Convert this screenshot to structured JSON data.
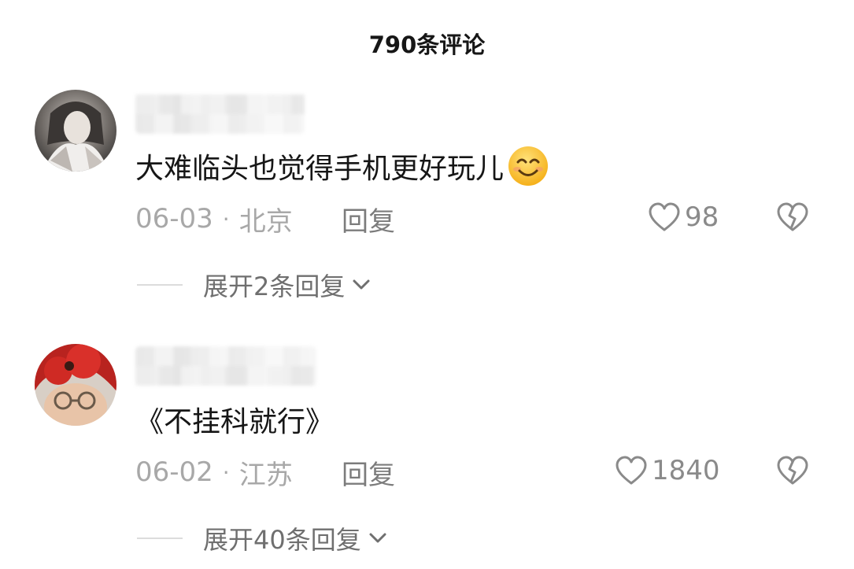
{
  "header": {
    "title": "790条评论"
  },
  "comments": [
    {
      "text": "大难临头也觉得手机更好玩儿",
      "emoji": "smiling-face-icon",
      "date": "06-03",
      "location": "北京",
      "reply_label": "回复",
      "likes": "98",
      "expand_label": "展开2条回复"
    },
    {
      "text": "《不挂科就行》",
      "date": "06-02",
      "location": "江苏",
      "reply_label": "回复",
      "likes": "1840",
      "expand_label": "展开40条回复"
    }
  ],
  "colors": {
    "meta_text": "#a8a8a8",
    "reply_text": "#7c7c7c",
    "icon_stroke": "#8a8a8a"
  }
}
